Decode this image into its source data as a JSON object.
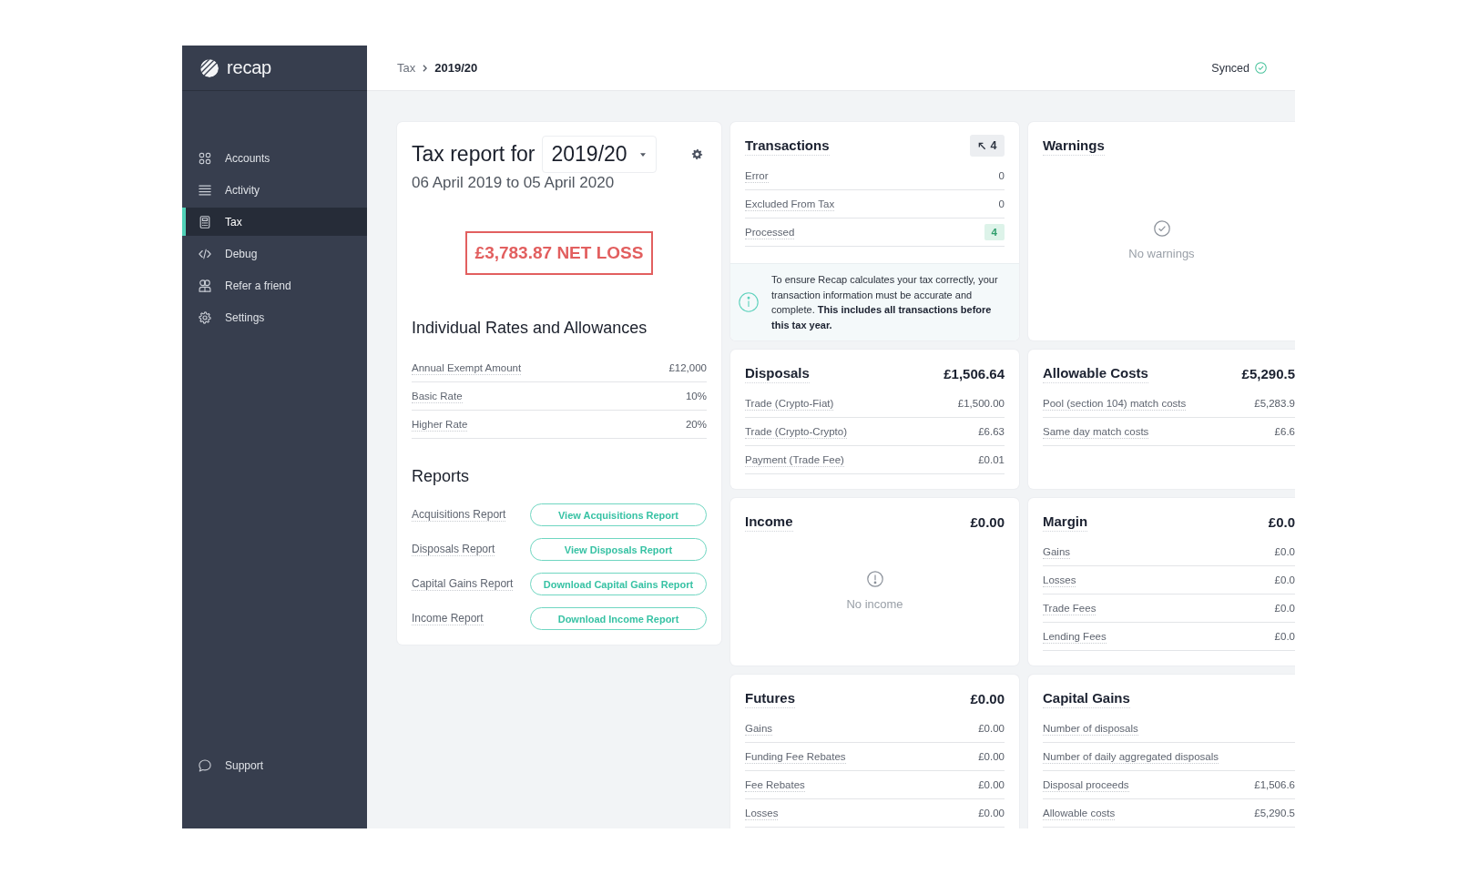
{
  "sidebar": {
    "logo": "recap",
    "items": [
      {
        "label": "Accounts",
        "selected": false
      },
      {
        "label": "Activity",
        "selected": false
      },
      {
        "label": "Tax",
        "selected": true
      },
      {
        "label": "Debug",
        "selected": false
      },
      {
        "label": "Refer a friend",
        "selected": false
      },
      {
        "label": "Settings",
        "selected": false
      }
    ],
    "footer_items": [
      {
        "label": "Support",
        "selected": false
      }
    ]
  },
  "header": {
    "breadcrumb": [
      "Tax",
      "2019/20"
    ],
    "sync_status": "Synced"
  },
  "report": {
    "title": "Tax report for",
    "year": "2019/20",
    "period": "06 April 2019 to 05 April 2020",
    "result": {
      "text": "£3,783.87 NET LOSS",
      "kind": "loss"
    },
    "rates": {
      "title": "Individual Rates and Allowances",
      "rows": [
        {
          "label": "Annual Exempt Amount",
          "value": "£12,000"
        },
        {
          "label": "Basic Rate",
          "value": "10%"
        },
        {
          "label": "Higher Rate",
          "value": "20%"
        }
      ]
    },
    "reports": {
      "title": "Reports",
      "rows": [
        {
          "label": "Acquisitions Report",
          "action": "View Acquisitions Report"
        },
        {
          "label": "Disposals Report",
          "action": "View Disposals Report"
        },
        {
          "label": "Capital Gains Report",
          "action": "Download Capital Gains Report"
        },
        {
          "label": "Income Report",
          "action": "Download Income Report"
        }
      ]
    }
  },
  "panels": [
    {
      "kind": "transactions",
      "title": "Transactions",
      "count": "4",
      "rows": [
        {
          "label": "Error",
          "value": "0",
          "highlighted": false
        },
        {
          "label": "Excluded From Tax",
          "value": "0",
          "highlighted": false
        },
        {
          "label": "Processed",
          "value": "4",
          "highlighted": true
        }
      ],
      "notice": "To ensure Recap calculates your tax correctly, your transaction information must be accurate and complete. **This includes all transactions before this tax year.**"
    },
    {
      "kind": "empty",
      "title": "Warnings",
      "empty_state": {
        "kind": "ok",
        "text": "No warnings"
      }
    },
    {
      "kind": "breakdown",
      "title": "Disposals",
      "total": "£1,506.64",
      "rows": [
        {
          "label": "Trade (Crypto-Fiat)",
          "value": "£1,500.00"
        },
        {
          "label": "Trade (Crypto-Crypto)",
          "value": "£6.63"
        },
        {
          "label": "Payment (Trade Fee)",
          "value": "£0.01"
        }
      ]
    },
    {
      "kind": "breakdown",
      "title": "Allowable Costs",
      "total": "£5,290.5",
      "rows": [
        {
          "label": "Pool (section 104) match costs",
          "value": "£5,283.9"
        },
        {
          "label": "Same day match costs",
          "value": "£6.6"
        }
      ]
    },
    {
      "kind": "empty",
      "title": "Income",
      "total": "£0.00",
      "empty_state": {
        "kind": "alert",
        "text": "No income"
      }
    },
    {
      "kind": "breakdown",
      "title": "Margin",
      "total": "£0.0",
      "rows": [
        {
          "label": "Gains",
          "value": "£0.0"
        },
        {
          "label": "Losses",
          "value": "£0.0"
        },
        {
          "label": "Trade Fees",
          "value": "£0.0"
        },
        {
          "label": "Lending Fees",
          "value": "£0.0"
        }
      ]
    },
    {
      "kind": "breakdown",
      "title": "Futures",
      "total": "£0.00",
      "rows": [
        {
          "label": "Gains",
          "value": "£0.00"
        },
        {
          "label": "Funding Fee Rebates",
          "value": "£0.00"
        },
        {
          "label": "Fee Rebates",
          "value": "£0.00"
        },
        {
          "label": "Losses",
          "value": "£0.00"
        }
      ]
    },
    {
      "kind": "breakdown",
      "title": "Capital Gains",
      "rows": [
        {
          "label": "Number of disposals"
        },
        {
          "label": "Number of daily aggregated disposals"
        },
        {
          "label": "Disposal proceeds",
          "value": "£1,506.6"
        },
        {
          "label": "Allowable costs",
          "value": "£5,290.5"
        }
      ]
    }
  ]
}
